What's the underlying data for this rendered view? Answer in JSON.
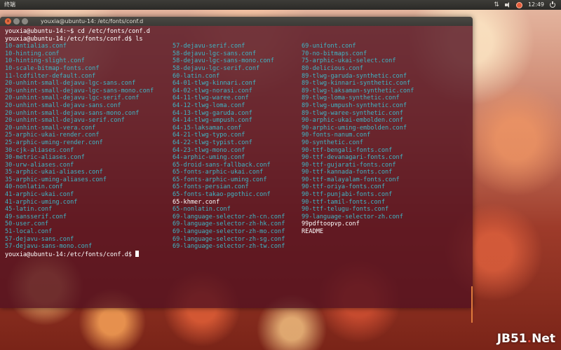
{
  "panel": {
    "app_title": "终端",
    "clock": "12:49",
    "tray_icons": [
      "network-icon",
      "volume-icon",
      "user-icon",
      "power-icon"
    ]
  },
  "window": {
    "title": "youxia@ubuntu-14: /etc/fonts/conf.d",
    "buttons": [
      "close",
      "minimize",
      "maximize"
    ]
  },
  "terminal": {
    "lines": [
      "youxia@ubuntu-14:~$ cd /etc/fonts/conf.d",
      "youxia@ubuntu-14:/etc/fonts/conf.d$ ls"
    ],
    "columns": [
      [
        "10-antialias.conf",
        "10-hinting.conf",
        "10-hinting-slight.conf",
        "10-scale-bitmap-fonts.conf",
        "11-lcdfilter-default.conf",
        "20-unhint-small-dejavu-lgc-sans.conf",
        "20-unhint-small-dejavu-lgc-sans-mono.conf",
        "20-unhint-small-dejavu-lgc-serif.conf",
        "20-unhint-small-dejavu-sans.conf",
        "20-unhint-small-dejavu-sans-mono.conf",
        "20-unhint-small-dejavu-serif.conf",
        "20-unhint-small-vera.conf",
        "25-arphic-ukai-render.conf",
        "25-arphic-uming-render.conf",
        "30-cjk-aliases.conf",
        "30-metric-aliases.conf",
        "30-urw-aliases.conf",
        "35-arphic-ukai-aliases.conf",
        "35-arphic-uming-aliases.conf",
        "40-nonlatin.conf",
        "41-arphic-ukai.conf",
        "41-arphic-uming.conf",
        "45-latin.conf",
        "49-sansserif.conf",
        "50-user.conf",
        "51-local.conf",
        "57-dejavu-sans.conf",
        "57-dejavu-sans-mono.conf"
      ],
      [
        "57-dejavu-serif.conf",
        "58-dejavu-lgc-sans.conf",
        "58-dejavu-lgc-sans-mono.conf",
        "58-dejavu-lgc-serif.conf",
        "60-latin.conf",
        "64-01-tlwg-kinnari.conf",
        "64-02-tlwg-norasi.conf",
        "64-11-tlwg-waree.conf",
        "64-12-tlwg-loma.conf",
        "64-13-tlwg-garuda.conf",
        "64-14-tlwg-umpush.conf",
        "64-15-laksaman.conf",
        "64-21-tlwg-typo.conf",
        "64-22-tlwg-typist.conf",
        "64-23-tlwg-mono.conf",
        "64-arphic-uming.conf",
        "65-droid-sans-fallback.conf",
        "65-fonts-arphic-ukai.conf",
        "65-fonts-arphic-uming.conf",
        "65-fonts-persian.conf",
        "65-fonts-takao-pgothic.conf",
        "65-khmer.conf",
        "65-nonlatin.conf",
        "69-language-selector-zh-cn.conf",
        "69-language-selector-zh-hk.conf",
        "69-language-selector-zh-mo.conf",
        "69-language-selector-zh-sg.conf",
        "69-language-selector-zh-tw.conf"
      ],
      [
        "69-unifont.conf",
        "70-no-bitmaps.conf",
        "75-arphic-ukai-select.conf",
        "80-delicious.conf",
        "89-tlwg-garuda-synthetic.conf",
        "89-tlwg-kinnari-synthetic.conf",
        "89-tlwg-laksaman-synthetic.conf",
        "89-tlwg-loma-synthetic.conf",
        "89-tlwg-umpush-synthetic.conf",
        "89-tlwg-waree-synthetic.conf",
        "90-arphic-ukai-embolden.conf",
        "90-arphic-uming-embolden.conf",
        "90-fonts-nanum.conf",
        "90-synthetic.conf",
        "90-ttf-bengali-fonts.conf",
        "90-ttf-devanagari-fonts.conf",
        "90-ttf-gujarati-fonts.conf",
        "90-ttf-kannada-fonts.conf",
        "90-ttf-malayalam-fonts.conf",
        "90-ttf-oriya-fonts.conf",
        "90-ttf-punjabi-fonts.conf",
        "90-ttf-tamil-fonts.conf",
        "90-ttf-telugu-fonts.conf",
        "99-language-selector-zh.conf",
        "99pdftoopvp.conf",
        "README"
      ]
    ],
    "plain_entries": [
      "65-khmer.conf",
      "99pdftoopvp.conf",
      "README"
    ],
    "prompt_final": "youxia@ubuntu-14:/etc/fonts/conf.d$ ",
    "link_color": "#3fb6c5",
    "text_color": "#ffffff"
  },
  "watermark": {
    "prefix": "JB51",
    "dot": ".",
    "suffix": "Net"
  }
}
